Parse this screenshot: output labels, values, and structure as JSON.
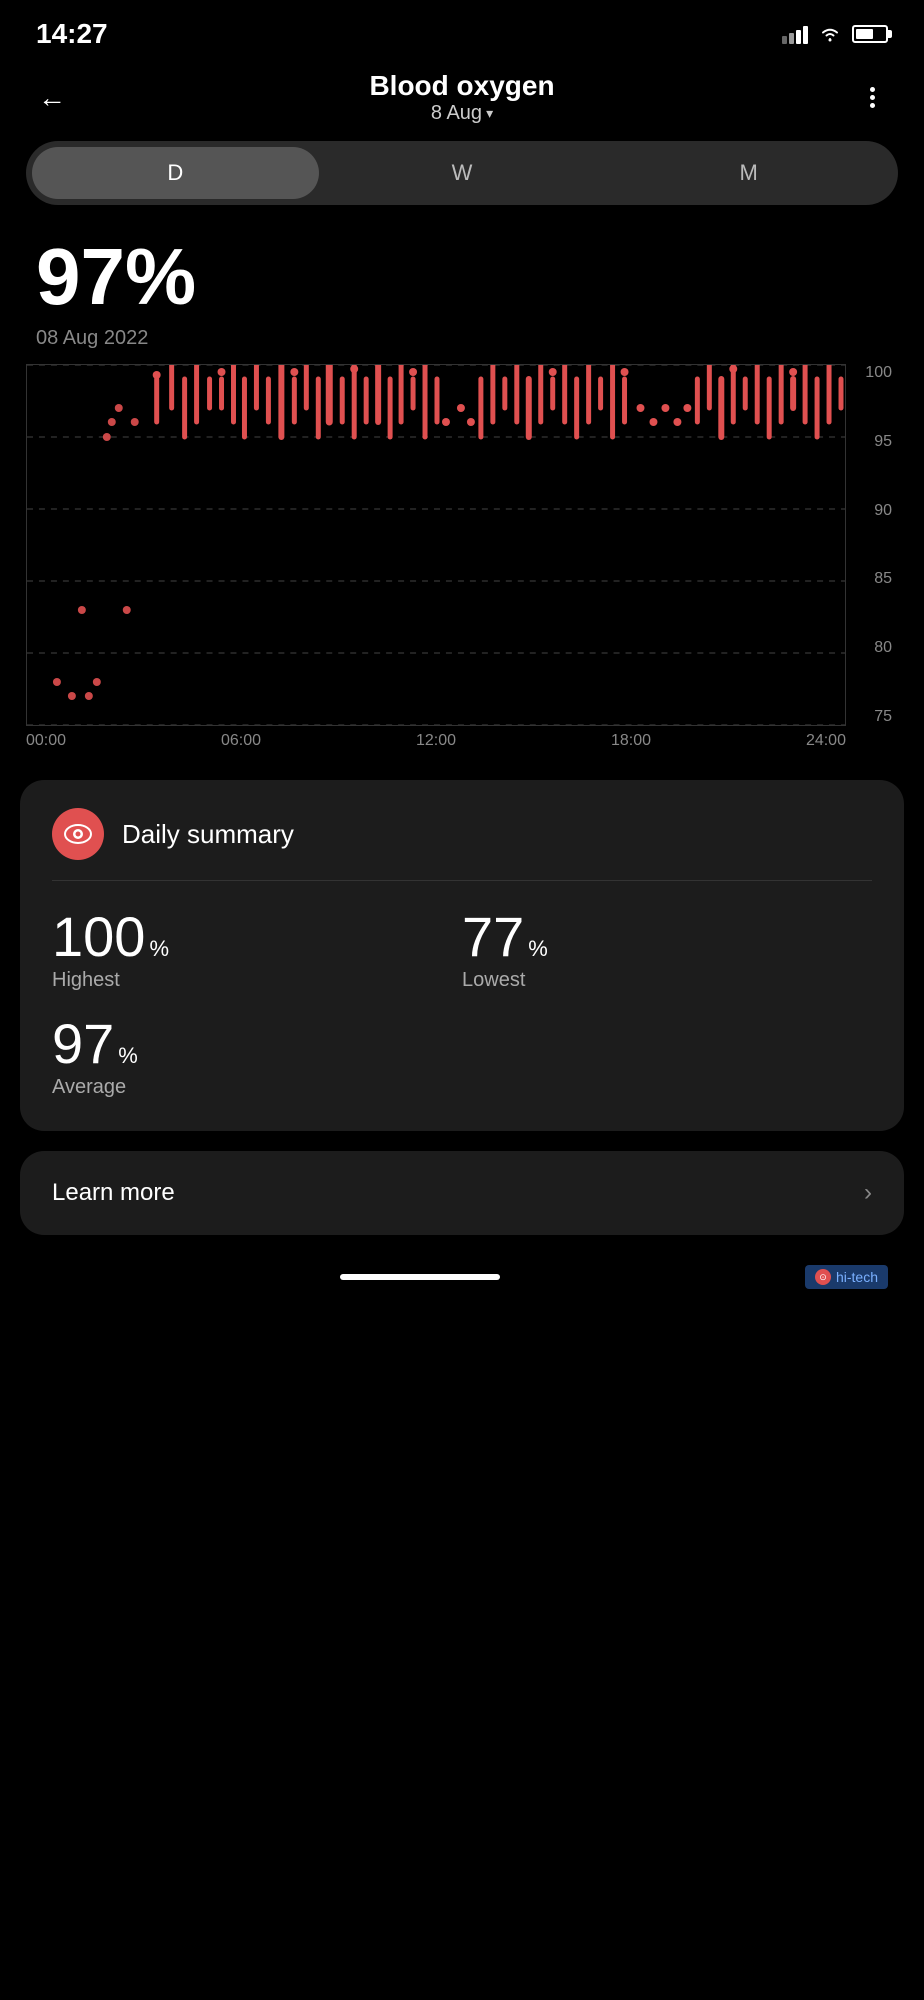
{
  "statusBar": {
    "time": "14:27",
    "signal": [
      40,
      60,
      80,
      100
    ],
    "batteryLevel": 60
  },
  "header": {
    "backLabel": "←",
    "title": "Blood oxygen",
    "date": "8 Aug",
    "moreMenuLabel": "⋮"
  },
  "tabs": [
    {
      "label": "D",
      "active": true
    },
    {
      "label": "W",
      "active": false
    },
    {
      "label": "M",
      "active": false
    }
  ],
  "mainValue": {
    "value": "97%",
    "dateLabel": "08 Aug 2022"
  },
  "chart": {
    "yLabels": [
      "100",
      "95",
      "90",
      "85",
      "80",
      "75"
    ],
    "xLabels": [
      "00:00",
      "06:00",
      "12:00",
      "18:00",
      "24:00"
    ]
  },
  "dailySummary": {
    "iconAlt": "eye-icon",
    "title": "Daily summary",
    "stats": [
      {
        "value": "100",
        "unit": "%",
        "label": "Highest"
      },
      {
        "value": "77",
        "unit": "%",
        "label": "Lowest"
      },
      {
        "value": "97",
        "unit": "%",
        "label": "Average"
      }
    ]
  },
  "learnMore": {
    "label": "Learn more",
    "chevron": "›"
  },
  "bottomBar": {
    "hitech": "hi-tech"
  }
}
